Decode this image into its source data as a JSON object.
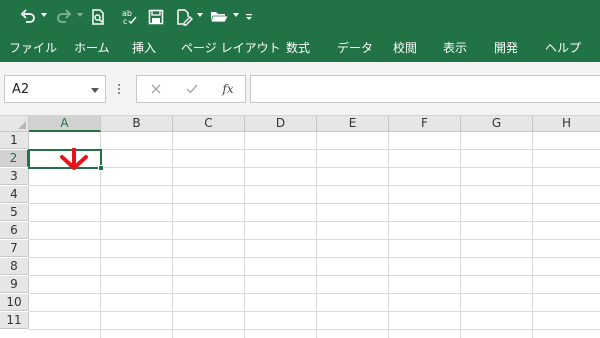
{
  "ribbon": {
    "tabs": [
      "ファイル",
      "ホーム",
      "挿入",
      "ページ レイアウト",
      "数式",
      "データ",
      "校閲",
      "表示",
      "開発",
      "ヘルプ"
    ]
  },
  "quick_access": {
    "icons": [
      "undo-icon",
      "redo-icon",
      "print-preview-icon",
      "spelling-icon",
      "save-icon",
      "edit-icon",
      "open-folder-icon",
      "customize-icon"
    ]
  },
  "formula_bar": {
    "name_box_value": "A2",
    "fx_label": "fx",
    "formula_value": ""
  },
  "grid": {
    "columns": [
      "A",
      "B",
      "C",
      "D",
      "E",
      "F",
      "G",
      "H"
    ],
    "rows": [
      "1",
      "2",
      "3",
      "4",
      "5",
      "6",
      "7",
      "8",
      "9",
      "10",
      "11"
    ],
    "selected_cell": "A2"
  },
  "colors": {
    "excel_green": "#217346",
    "annotation_red": "#e8141b",
    "gridline": "#dadada"
  }
}
